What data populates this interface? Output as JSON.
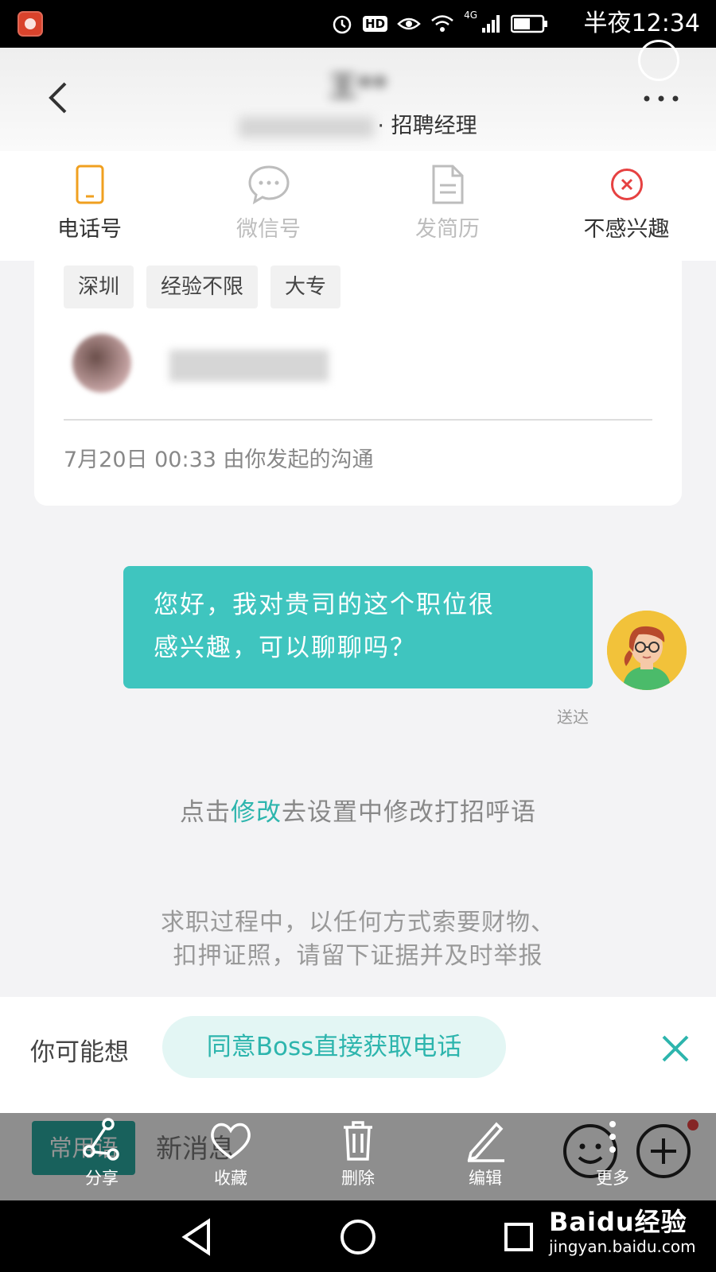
{
  "status_bar": {
    "network": "4G",
    "hd": "HD",
    "time": "半夜12:34"
  },
  "header": {
    "title": "王**",
    "subtitle_role": "· 招聘经理"
  },
  "actions": [
    {
      "label": "电话号",
      "icon": "phone-icon",
      "color": "#f0a020",
      "enabled": true
    },
    {
      "label": "微信号",
      "icon": "wechat-icon",
      "color": "#bdbdbd",
      "enabled": false
    },
    {
      "label": "发简历",
      "icon": "resume-icon",
      "color": "#bdbdbd",
      "enabled": false
    },
    {
      "label": "不感兴趣",
      "icon": "not-interested-icon",
      "color": "#e64141",
      "enabled": true
    }
  ],
  "job_card": {
    "tags": [
      "深圳",
      "经验不限",
      "大专"
    ],
    "started": "7月20日 00:33 由你发起的沟通"
  },
  "message": {
    "text_line1": "您好，我对贵司的这个职位很",
    "text_line2": "感兴趣，可以聊聊吗？",
    "status": "送达"
  },
  "hint": {
    "prefix": "点击",
    "link": "修改",
    "suffix": "去设置中修改打招呼语"
  },
  "warning": {
    "line1": "求职过程中，以任何方式索要财物、",
    "line2": "扣押证照，请留下证据并及时举报"
  },
  "suggestion": {
    "label": "你可能想",
    "action": "同意Boss直接获取电话"
  },
  "input_bar": {
    "phrases": "常用语",
    "placeholder": "新消息"
  },
  "share_menu": [
    {
      "label": "分享",
      "icon": "share-icon"
    },
    {
      "label": "收藏",
      "icon": "heart-icon"
    },
    {
      "label": "删除",
      "icon": "trash-icon"
    },
    {
      "label": "编辑",
      "icon": "pencil-icon"
    },
    {
      "label": "更多",
      "icon": "more-vertical-icon"
    }
  ],
  "watermark": {
    "main": "Baidu经验",
    "sub": "jingyan.baidu.com"
  },
  "colors": {
    "accent": "#3fc5bf",
    "link": "#2db5ad",
    "phone": "#f0a020",
    "danger": "#e64141"
  }
}
